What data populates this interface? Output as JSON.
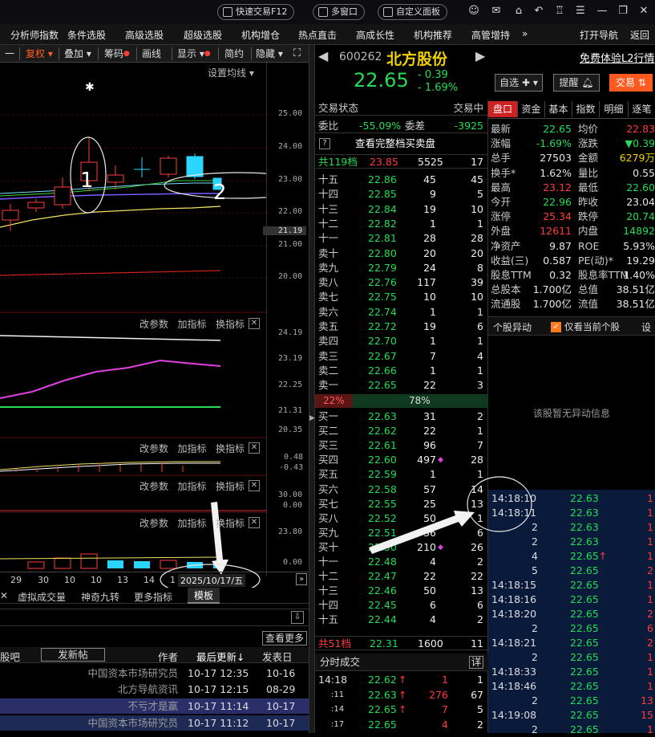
{
  "titlebar": {
    "quick_trade": "快速交易F12",
    "multi_window": "多窗口",
    "custom_panel": "自定义面板"
  },
  "menu": [
    "分析师指数",
    "条件选股",
    "高级选股",
    "超级选股",
    "机构增仓",
    "热点直击",
    "高成长性",
    "机构推荐",
    "高管增持",
    "»",
    "打开导航",
    "返回"
  ],
  "toolbar": {
    "items": [
      "一",
      "复权",
      "叠加",
      "筹码",
      "画线",
      "显示",
      "简约",
      "隐藏"
    ],
    "ma_settings": "设置均线"
  },
  "chart": {
    "price_axis": [
      "25.00",
      "24.00",
      "23.00",
      "22.00",
      "21.19",
      "21.00",
      "20.00"
    ],
    "sub_panels": [
      {
        "buttons": [
          "改参数",
          "加指标",
          "换指标"
        ],
        "axis": [
          "24.19",
          "23.19",
          "22.25",
          "21.31",
          "20.35"
        ]
      },
      {
        "buttons": [
          "改参数",
          "加指标",
          "换指标"
        ],
        "axis": [
          "0.48",
          "-0.43"
        ]
      },
      {
        "buttons": [
          "改参数",
          "加指标",
          "换指标"
        ],
        "axis": [
          "30.00",
          "0.00"
        ]
      },
      {
        "buttons": [
          "改参数",
          "加指标",
          "换指标"
        ],
        "axis": [
          "23.80",
          "0.00"
        ]
      }
    ],
    "x_labels": [
      "29",
      "30",
      "10",
      "10",
      "13",
      "14",
      "1"
    ],
    "date_box": "2025/10/17/五",
    "annotations": [
      "1",
      "2"
    ]
  },
  "bottom": {
    "tabs": [
      "虚拟成交量",
      "神奇九转",
      "更多指标",
      "模板"
    ],
    "more_btn": "查看更多",
    "forum_header": {
      "left": "股吧",
      "post": "发新帖",
      "author": "作者",
      "last_update": "最后更新↓",
      "publish": "发表日"
    },
    "posts": [
      {
        "author": "中国资本市场研究员",
        "update": "10-17 12:35",
        "date": "10-16"
      },
      {
        "author": "北方导航资讯",
        "update": "10-17 12:15",
        "date": "08-29"
      },
      {
        "author": "不亏才是赢",
        "update": "10-17 11:14",
        "date": "10-17"
      },
      {
        "author": "中国资本市场研究员",
        "update": "10-17 11:12",
        "date": "10-17"
      }
    ]
  },
  "stock": {
    "code": "600262",
    "name": "北方股份",
    "price": "22.65",
    "change": "- 0.39",
    "pct": "- 1.69%",
    "btn_watch": "自选",
    "btn_alert": "提醒",
    "btn_trade": "交易",
    "trial": "免费体验L2行情"
  },
  "orderbook": {
    "status_label": "交易状态",
    "status_value": "交易中",
    "weibi_label": "委比",
    "weibi": "-55.09%",
    "weicha_label": "委差",
    "weicha": "-3925",
    "full_link": "查看完整档买卖盘",
    "sell_total": {
      "label": "共119档",
      "price": "23.85",
      "vol": "5525",
      "count": "17"
    },
    "asks": [
      [
        "十五",
        "22.86",
        "45",
        "45"
      ],
      [
        "十四",
        "22.85",
        "9",
        "5"
      ],
      [
        "十三",
        "22.84",
        "19",
        "10"
      ],
      [
        "十二",
        "22.82",
        "1",
        "1"
      ],
      [
        "十一",
        "22.81",
        "28",
        "28"
      ],
      [
        "卖十",
        "22.80",
        "20",
        "20"
      ],
      [
        "卖九",
        "22.79",
        "24",
        "8"
      ],
      [
        "卖八",
        "22.76",
        "117",
        "39"
      ],
      [
        "卖七",
        "22.75",
        "10",
        "10"
      ],
      [
        "卖六",
        "22.74",
        "1",
        "1"
      ],
      [
        "卖五",
        "22.72",
        "19",
        "6"
      ],
      [
        "卖四",
        "22.70",
        "1",
        "1"
      ],
      [
        "卖三",
        "22.67",
        "7",
        "4"
      ],
      [
        "卖二",
        "22.66",
        "1",
        "1"
      ],
      [
        "卖一",
        "22.65",
        "22",
        "3"
      ]
    ],
    "ratio_sell": "22%",
    "ratio_buy": "78%",
    "bids": [
      [
        "买一",
        "22.63",
        "31",
        "2"
      ],
      [
        "买二",
        "22.62",
        "22",
        "1"
      ],
      [
        "买三",
        "22.61",
        "96",
        "7"
      ],
      [
        "买四",
        "22.60",
        "497",
        "28"
      ],
      [
        "买五",
        "22.59",
        "1",
        "1"
      ],
      [
        "买六",
        "22.58",
        "57",
        "14"
      ],
      [
        "买七",
        "22.55",
        "25",
        "13"
      ],
      [
        "买八",
        "22.52",
        "50",
        "1"
      ],
      [
        "买九",
        "22.51",
        "36",
        "6"
      ],
      [
        "买十",
        "22.50",
        "210",
        "26"
      ],
      [
        "十一",
        "22.48",
        "4",
        "2"
      ],
      [
        "十二",
        "22.47",
        "22",
        "22"
      ],
      [
        "十三",
        "22.46",
        "50",
        "13"
      ],
      [
        "十四",
        "22.45",
        "6",
        "6"
      ],
      [
        "十五",
        "22.44",
        "4",
        "2"
      ]
    ],
    "buy_total": {
      "label": "共51档",
      "price": "22.31",
      "vol": "1600",
      "count": "11"
    },
    "ticks_title": "分时成交",
    "ticks_detail": "详",
    "ticks": [
      [
        "14:18",
        "22.62",
        "1",
        "1"
      ],
      [
        ":11",
        "22.63",
        "276",
        "67"
      ],
      [
        ":14",
        "22.65",
        "7",
        "5"
      ],
      [
        ":17",
        "22.65",
        "4",
        "2"
      ]
    ]
  },
  "quote": {
    "tabs": [
      "盘口",
      "资金",
      "基本",
      "指数",
      "明细",
      "逐笔"
    ],
    "rows": [
      [
        "最新",
        "22.65",
        "均价",
        "22.83"
      ],
      [
        "涨幅",
        "-1.69%",
        "涨跌",
        "▼0.39"
      ],
      [
        "总手",
        "27503",
        "金额",
        "6279万"
      ],
      [
        "换手*",
        "1.62%",
        "量比",
        "0.55"
      ],
      [
        "最高",
        "23.12",
        "最低",
        "22.60"
      ],
      [
        "今开",
        "22.96",
        "昨收",
        "23.04"
      ],
      [
        "涨停",
        "25.34",
        "跌停",
        "20.74"
      ],
      [
        "外盘",
        "12611",
        "内盘",
        "14892"
      ],
      [
        "净资产",
        "9.87",
        "ROE",
        "5.93%"
      ],
      [
        "收益(三)",
        "0.587",
        "PE(动)*",
        "19.29"
      ],
      [
        "股息TTM",
        "0.32",
        "股息率TTM",
        "1.40%"
      ],
      [
        "总股本",
        "1.700亿",
        "总值",
        "38.51亿"
      ],
      [
        "流通股",
        "1.700亿",
        "流值",
        "38.51亿"
      ]
    ],
    "anomaly_title": "个股异动",
    "anomaly_check": "仅看当前个股",
    "anomaly_settings": "设",
    "anomaly_empty": "该股暂无异动信息",
    "trades": [
      [
        "14:18:10",
        "22.63",
        "1"
      ],
      [
        "14:18:11",
        "22.63",
        "1"
      ],
      [
        "2",
        "22.63",
        "1"
      ],
      [
        "2",
        "22.63",
        "1"
      ],
      [
        "4",
        "22.65↑",
        "1"
      ],
      [
        "5",
        "22.65",
        "2"
      ],
      [
        "14:18:15",
        "22.65",
        "1"
      ],
      [
        "14:18:16",
        "22.65",
        "1"
      ],
      [
        "14:18:20",
        "22.65",
        "2"
      ],
      [
        "2",
        "22.65",
        "6"
      ],
      [
        "14:18:21",
        "22.65",
        "2"
      ],
      [
        "2",
        "22.65",
        "1"
      ],
      [
        "14:18:33",
        "22.65",
        "1"
      ],
      [
        "14:18:46",
        "22.65",
        "1"
      ],
      [
        "2",
        "22.65",
        "13"
      ],
      [
        "14:19:08",
        "22.65",
        "15"
      ],
      [
        "2",
        "22.65",
        "1"
      ]
    ]
  },
  "colors": {
    "up": "#ff3b3b",
    "down": "#22dd55",
    "accent": "#ff5a1f",
    "cyan": "#2ad6ff"
  }
}
